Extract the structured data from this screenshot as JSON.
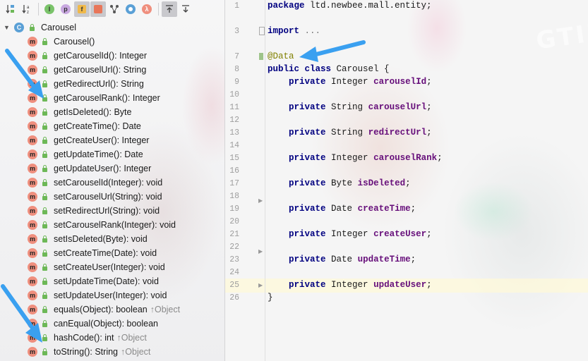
{
  "toolbar": {
    "buttons": [
      {
        "name": "sort-by-visibility-icon",
        "glyph": "↓₂"
      },
      {
        "name": "sort-alphabetically-icon",
        "glyph": "↓a"
      },
      {
        "name": "show-interfaces-icon",
        "glyph": "I"
      },
      {
        "name": "show-properties-icon",
        "glyph": "p"
      },
      {
        "name": "show-fields-icon",
        "glyph": "f"
      },
      {
        "name": "show-non-public-icon",
        "glyph": "■"
      },
      {
        "name": "show-inherited-icon",
        "glyph": "⅄"
      },
      {
        "name": "show-anonymous-icon",
        "glyph": "◎"
      },
      {
        "name": "show-lambdas-icon",
        "glyph": "λ"
      },
      {
        "name": "expand-all-icon",
        "glyph": "⤒"
      },
      {
        "name": "collapse-all-icon",
        "glyph": "⤓"
      }
    ]
  },
  "tree": {
    "root": {
      "icon_letter": "C",
      "label": "Carousel"
    },
    "method_icon_letter": "m",
    "items": [
      {
        "label": "Carousel()"
      },
      {
        "label": "getCarouselId(): Integer"
      },
      {
        "label": "getCarouselUrl(): String"
      },
      {
        "label": "getRedirectUrl(): String"
      },
      {
        "label": "getCarouselRank(): Integer"
      },
      {
        "label": "getIsDeleted(): Byte"
      },
      {
        "label": "getCreateTime(): Date"
      },
      {
        "label": "getCreateUser(): Integer"
      },
      {
        "label": "getUpdateTime(): Date"
      },
      {
        "label": "getUpdateUser(): Integer"
      },
      {
        "label": "setCarouselId(Integer): void"
      },
      {
        "label": "setCarouselUrl(String): void"
      },
      {
        "label": "setRedirectUrl(String): void"
      },
      {
        "label": "setCarouselRank(Integer): void"
      },
      {
        "label": "setIsDeleted(Byte): void"
      },
      {
        "label": "setCreateTime(Date): void"
      },
      {
        "label": "setCreateUser(Integer): void"
      },
      {
        "label": "setUpdateTime(Date): void"
      },
      {
        "label": "setUpdateUser(Integer): void"
      },
      {
        "label": "equals(Object): boolean",
        "inherited": "↑Object"
      },
      {
        "label": "canEqual(Object): boolean"
      },
      {
        "label": "hashCode(): int",
        "inherited": "↑Object"
      },
      {
        "label": "toString(): String",
        "inherited": "↑Object"
      }
    ]
  },
  "editor": {
    "line_numbers": [
      "1",
      "3",
      "7",
      "8",
      "9",
      "10",
      "11",
      "12",
      "13",
      "14",
      "15",
      "16",
      "17",
      "18",
      "19",
      "20",
      "21",
      "22",
      "23",
      "24",
      "25",
      "26"
    ],
    "code": {
      "l1_kw": "package",
      "l1_rest": " ltd.newbee.mall.entity;",
      "l3_kw": "import",
      "l3_rest": " ...",
      "l7_ann": "@Data",
      "l8_kw1": "public",
      "l8_kw2": "class",
      "l8_rest": " Carousel {",
      "private_kw": "private",
      "fields": [
        {
          "type": "Integer",
          "name": "carouselId"
        },
        {
          "type": "String",
          "name": "carouselUrl"
        },
        {
          "type": "String",
          "name": "redirectUrl"
        },
        {
          "type": "Integer",
          "name": "carouselRank"
        },
        {
          "type": "Byte",
          "name": "isDeleted"
        },
        {
          "type": "Date",
          "name": "createTime"
        },
        {
          "type": "Integer",
          "name": "createUser"
        },
        {
          "type": "Date",
          "name": "updateTime"
        },
        {
          "type": "Integer",
          "name": "updateUser"
        }
      ],
      "closing_brace": "}"
    },
    "background_text": "GTING!"
  },
  "colors": {
    "keyword": "#000080",
    "field": "#660e7a",
    "annotation": "#808000",
    "callout_arrow": "#3aa0f0"
  }
}
